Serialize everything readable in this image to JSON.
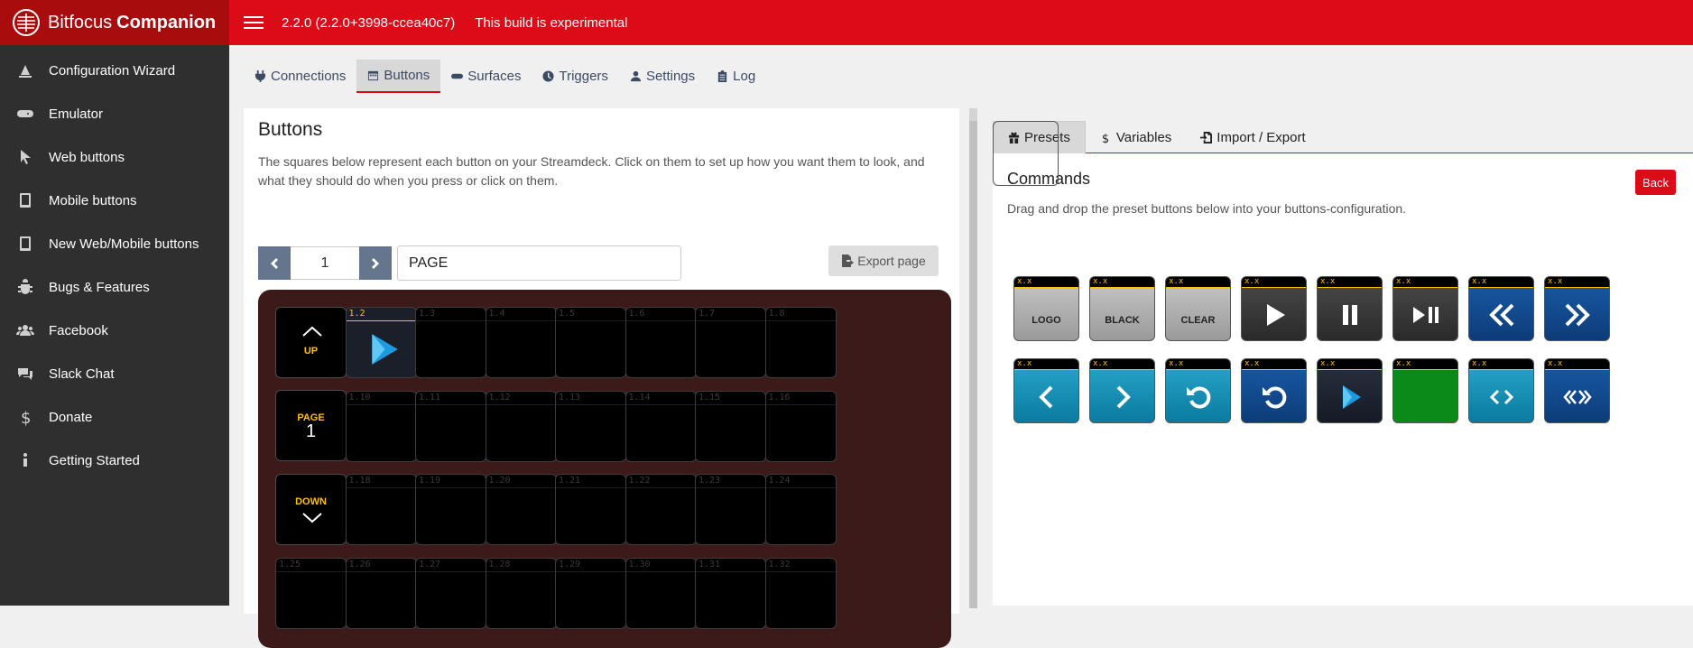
{
  "brand": {
    "name": "Bitfocus",
    "name_bold": "Companion"
  },
  "header": {
    "version": "2.2.0 (2.2.0+3998-ccea40c7)",
    "warning": "This build is experimental"
  },
  "sidebar": {
    "items": [
      {
        "label": "Configuration Wizard",
        "icon": "wizard-icon"
      },
      {
        "label": "Emulator",
        "icon": "gamepad-icon"
      },
      {
        "label": "Web buttons",
        "icon": "pointer-icon"
      },
      {
        "label": "Mobile buttons",
        "icon": "tablet-icon"
      },
      {
        "label": "New Web/Mobile buttons",
        "icon": "tablet-icon"
      },
      {
        "label": "Bugs & Features",
        "icon": "bug-icon"
      },
      {
        "label": "Facebook",
        "icon": "users-icon"
      },
      {
        "label": "Slack Chat",
        "icon": "comments-icon"
      },
      {
        "label": "Donate",
        "icon": "dollar-icon"
      },
      {
        "label": "Getting Started",
        "icon": "info-icon"
      }
    ]
  },
  "tabs": [
    {
      "label": "Connections",
      "icon": "plug-icon"
    },
    {
      "label": "Buttons",
      "icon": "calendar-icon"
    },
    {
      "label": "Surfaces",
      "icon": "gamepad-icon"
    },
    {
      "label": "Triggers",
      "icon": "clock-icon"
    },
    {
      "label": "Settings",
      "icon": "user-cog-icon"
    },
    {
      "label": "Log",
      "icon": "clipboard-icon"
    }
  ],
  "buttons_panel": {
    "title": "Buttons",
    "description": "The squares below represent each button on your Streamdeck. Click on them to set up how you want them to look, and what they should do when you press or click on them.",
    "page_number": "1",
    "page_name": "PAGE",
    "export_label": "Export page",
    "nav": {
      "up": "UP",
      "page": "PAGE",
      "page_num": "1",
      "down": "DOWN"
    },
    "keys": [
      "1.2",
      "1.3",
      "1.4",
      "1.5",
      "1.6",
      "1.7",
      "1.8",
      "1.10",
      "1.11",
      "1.12",
      "1.13",
      "1.14",
      "1.15",
      "1.16",
      "1.18",
      "1.19",
      "1.20",
      "1.21",
      "1.22",
      "1.23",
      "1.24",
      "1.25",
      "1.26",
      "1.27",
      "1.28",
      "1.29",
      "1.30",
      "1.31",
      "1.32"
    ]
  },
  "right_panel": {
    "tabs": [
      {
        "label": "Presets",
        "icon": "gift-icon"
      },
      {
        "label": "Variables",
        "icon": "dollar-icon"
      },
      {
        "label": "Import / Export",
        "icon": "file-import-icon"
      }
    ],
    "title": "Commands",
    "back_label": "Back",
    "description": "Drag and drop the preset buttons below into your buttons-configuration.",
    "preset_label": "x.x",
    "presets_text": [
      "LOGO",
      "BLACK",
      "CLEAR"
    ]
  },
  "colors": {
    "header_red": "#dc0b18",
    "brand_red": "#a90c0c",
    "sidebar": "#2f2f2f",
    "key_accent": "#ffc000"
  }
}
